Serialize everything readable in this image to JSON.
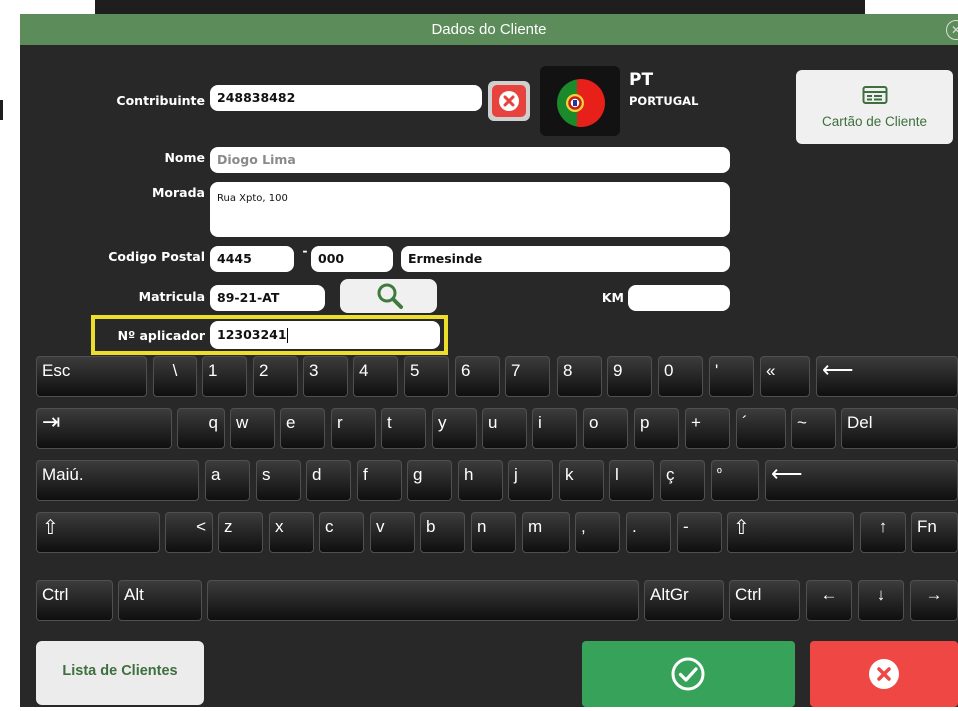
{
  "window": {
    "title": "Dados do Cliente"
  },
  "form": {
    "contribuinte": {
      "label": "Contribuinte",
      "value": "248838482"
    },
    "country": {
      "code": "PT",
      "name": "PORTUGAL"
    },
    "card_button": {
      "label": "Cartão de Cliente"
    },
    "nome": {
      "label": "Nome",
      "value": "Diogo Lima"
    },
    "morada": {
      "label": "Morada",
      "value": "Rua Xpto, 100"
    },
    "codigo_postal": {
      "label": "Codigo Postal",
      "part1": "4445",
      "separator": "-",
      "part2": "000",
      "locality": "Ermesinde"
    },
    "matricula": {
      "label": "Matricula",
      "value": "89-21-AT"
    },
    "km": {
      "label": "KM",
      "value": ""
    },
    "aplicador": {
      "label": "Nº aplicador",
      "value": "12303241"
    }
  },
  "keyboard": {
    "row1": [
      "Esc",
      "\\",
      "1",
      "2",
      "3",
      "4",
      "5",
      "6",
      "7",
      "8",
      "9",
      "0",
      "'",
      "«",
      "⟵"
    ],
    "row2": [
      "⇥",
      "q",
      "w",
      "e",
      "r",
      "t",
      "y",
      "u",
      "i",
      "o",
      "p",
      "+",
      "´",
      "~",
      "Del"
    ],
    "row3": [
      "Maiú.",
      "a",
      "s",
      "d",
      "f",
      "g",
      "h",
      "j",
      "k",
      "l",
      "ç",
      "º",
      "⟵"
    ],
    "row4": [
      "⇧",
      "<",
      "z",
      "x",
      "c",
      "v",
      "b",
      "n",
      "m",
      ",",
      ".",
      "-",
      "⇧",
      "↑",
      "Fn"
    ],
    "row5": [
      "Ctrl",
      "Alt",
      "",
      "AltGr",
      "Ctrl",
      "←",
      "↓",
      "→"
    ]
  },
  "buttons": {
    "list_clients": "Lista de Clientes",
    "confirm": "check-circle-icon",
    "cancel": "close-circle-icon"
  },
  "colors": {
    "titlebar": "#5c8c5a",
    "confirm": "#37a35a",
    "cancel": "#ee4744",
    "highlight": "#ecde2b",
    "accent_text": "#3e6f3e"
  }
}
